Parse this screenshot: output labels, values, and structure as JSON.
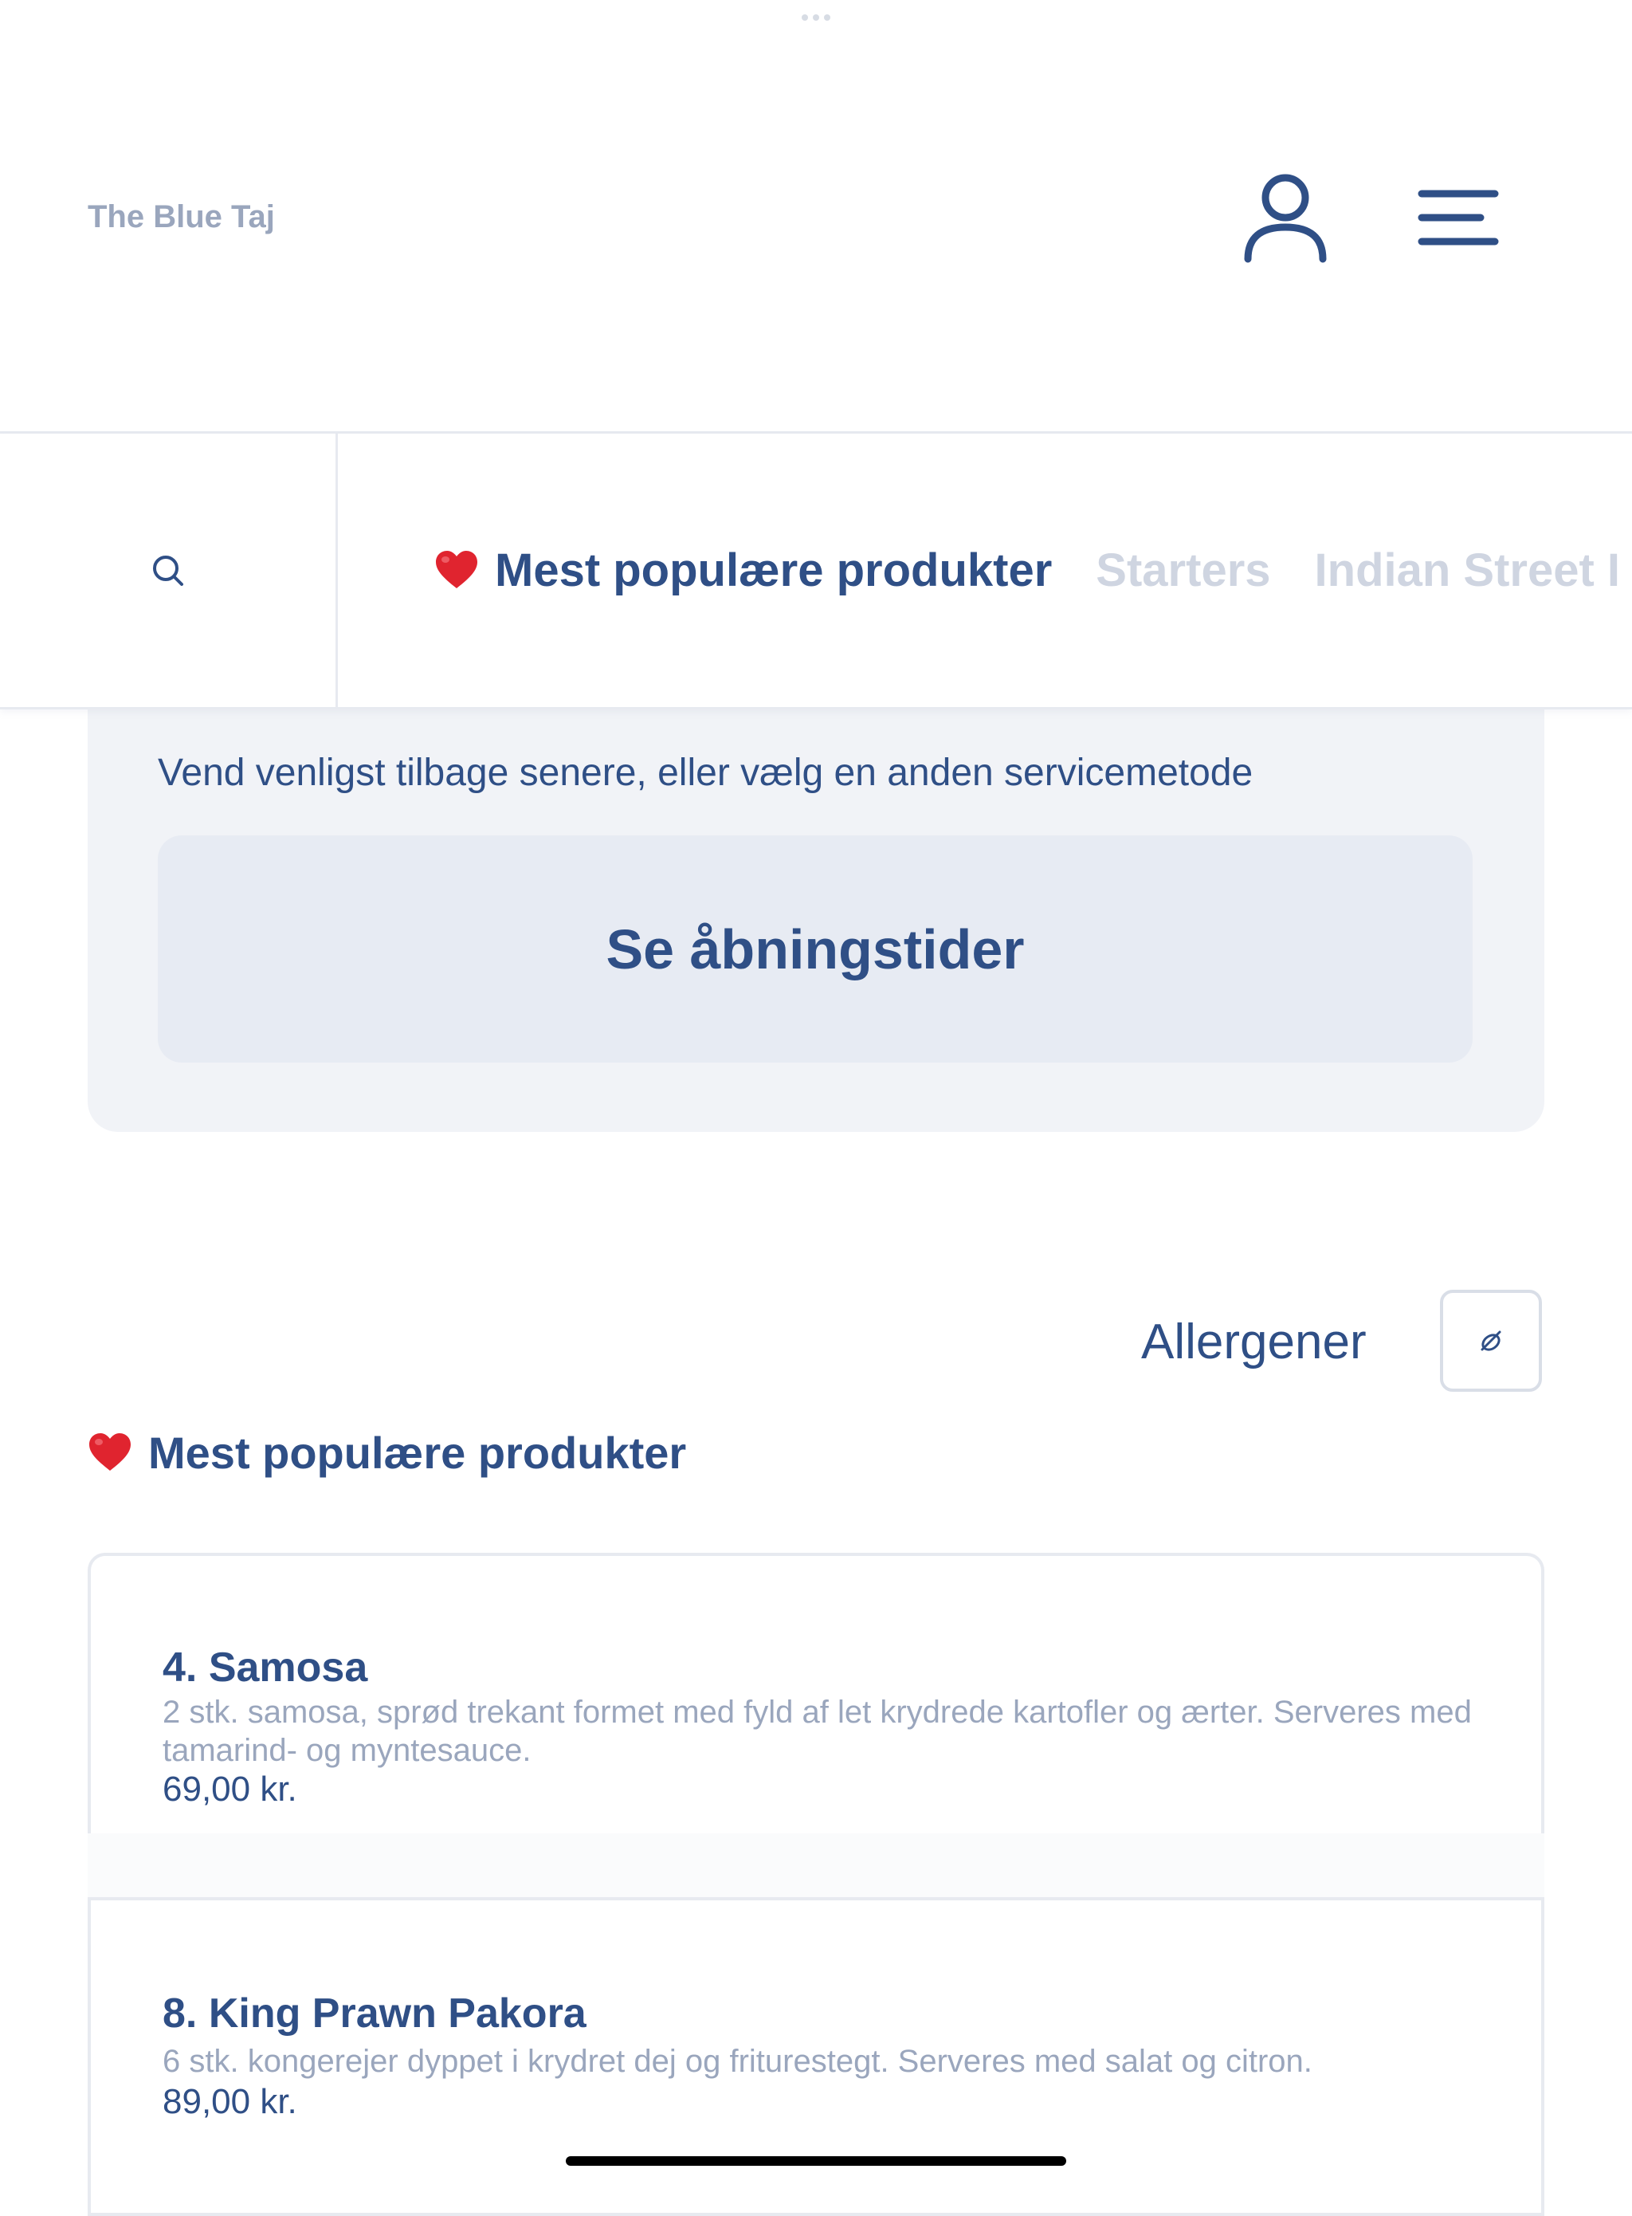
{
  "header": {
    "brand": "The Blue Taj"
  },
  "nav": {
    "categories": [
      {
        "label": "Mest populære produkter",
        "active": true
      },
      {
        "label": "Starters",
        "active": false
      },
      {
        "label": "Indian Street I",
        "active": false
      }
    ]
  },
  "notice": {
    "message": "Vend venligst tilbage senere, eller vælg en anden servicemetode",
    "hours_button": "Se åbningstider"
  },
  "allergens": {
    "label": "Allergener"
  },
  "section": {
    "title": "Mest populære produkter"
  },
  "products": [
    {
      "name": "4. Samosa",
      "description": "2 stk. samosa, sprød trekant formet med fyld af let krydrede kartofler og ærter. Serveres med tamarind- og myntesauce.",
      "price": "69,00 kr."
    },
    {
      "name": "8. King Prawn Pakora",
      "description": "6 stk. kongerejer dyppet i krydret dej og friturestegt. Serveres med salat og citron.",
      "price": "89,00 kr."
    }
  ],
  "colors": {
    "primary": "#2f4f86",
    "muted": "#9aa6bd",
    "inactive_tab": "#cfd5e1",
    "notice_bg": "#f1f3f7",
    "heart": "#e0242f"
  },
  "icons": {
    "user": "user-icon",
    "menu": "hamburger-menu-icon",
    "search": "search-icon",
    "heart": "heart-icon",
    "allergen": "allergen-filter-icon"
  }
}
